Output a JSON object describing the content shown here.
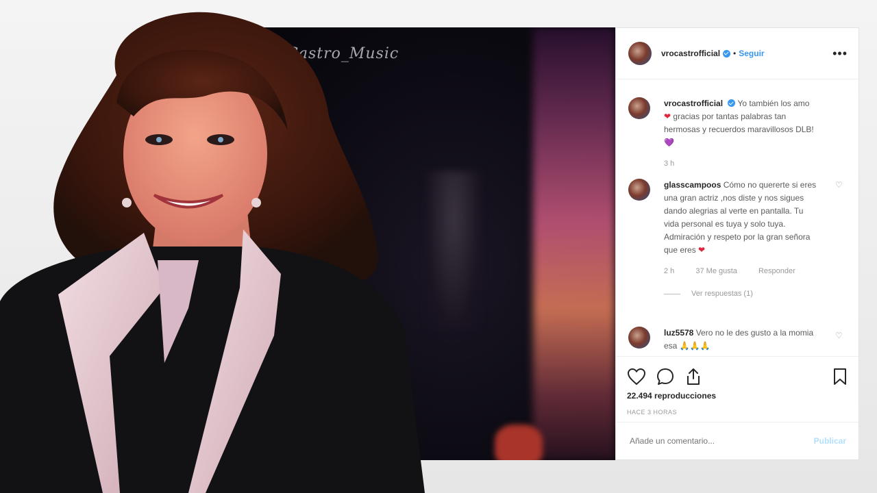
{
  "video": {
    "watermark": "Castro_Music"
  },
  "post": {
    "username": "vrocastrofficial",
    "follow_label": "Seguir",
    "more_label": "•••"
  },
  "comments": [
    {
      "username": "vrocastrofficial",
      "text_1": "Yo también los amo",
      "emoji_1": "❤",
      "text_2": "gracias por tantas palabras tan hermosas y recuerdos maravillosos DLB!",
      "emoji_2": "💜",
      "time": "3 h"
    },
    {
      "username": "glasscampoos",
      "text": "Cómo no quererte si eres una gran actriz ,nos diste y nos sigues dando alegrias al verte en pantalla. Tu vida personal es tuya y solo tuya. Admiración y respeto por la gran señora que eres",
      "emoji": "❤",
      "time": "2 h",
      "likes": "37 Me gusta",
      "reply_label": "Responder",
      "view_replies": "Ver respuestas (1)"
    },
    {
      "username": "luz5578",
      "text": "Vero no le des gusto a la momia esa",
      "emoji": "🙏🙏🙏"
    }
  ],
  "stats": {
    "views": "22.494 reproducciones",
    "ago": "HACE 3 HORAS"
  },
  "add_comment": {
    "placeholder": "Añade un comentario...",
    "publish_label": "Publicar"
  },
  "colors": {
    "accent": "#3897f0",
    "publish_disabled": "#b2dffc",
    "heart": "#e0243c"
  }
}
